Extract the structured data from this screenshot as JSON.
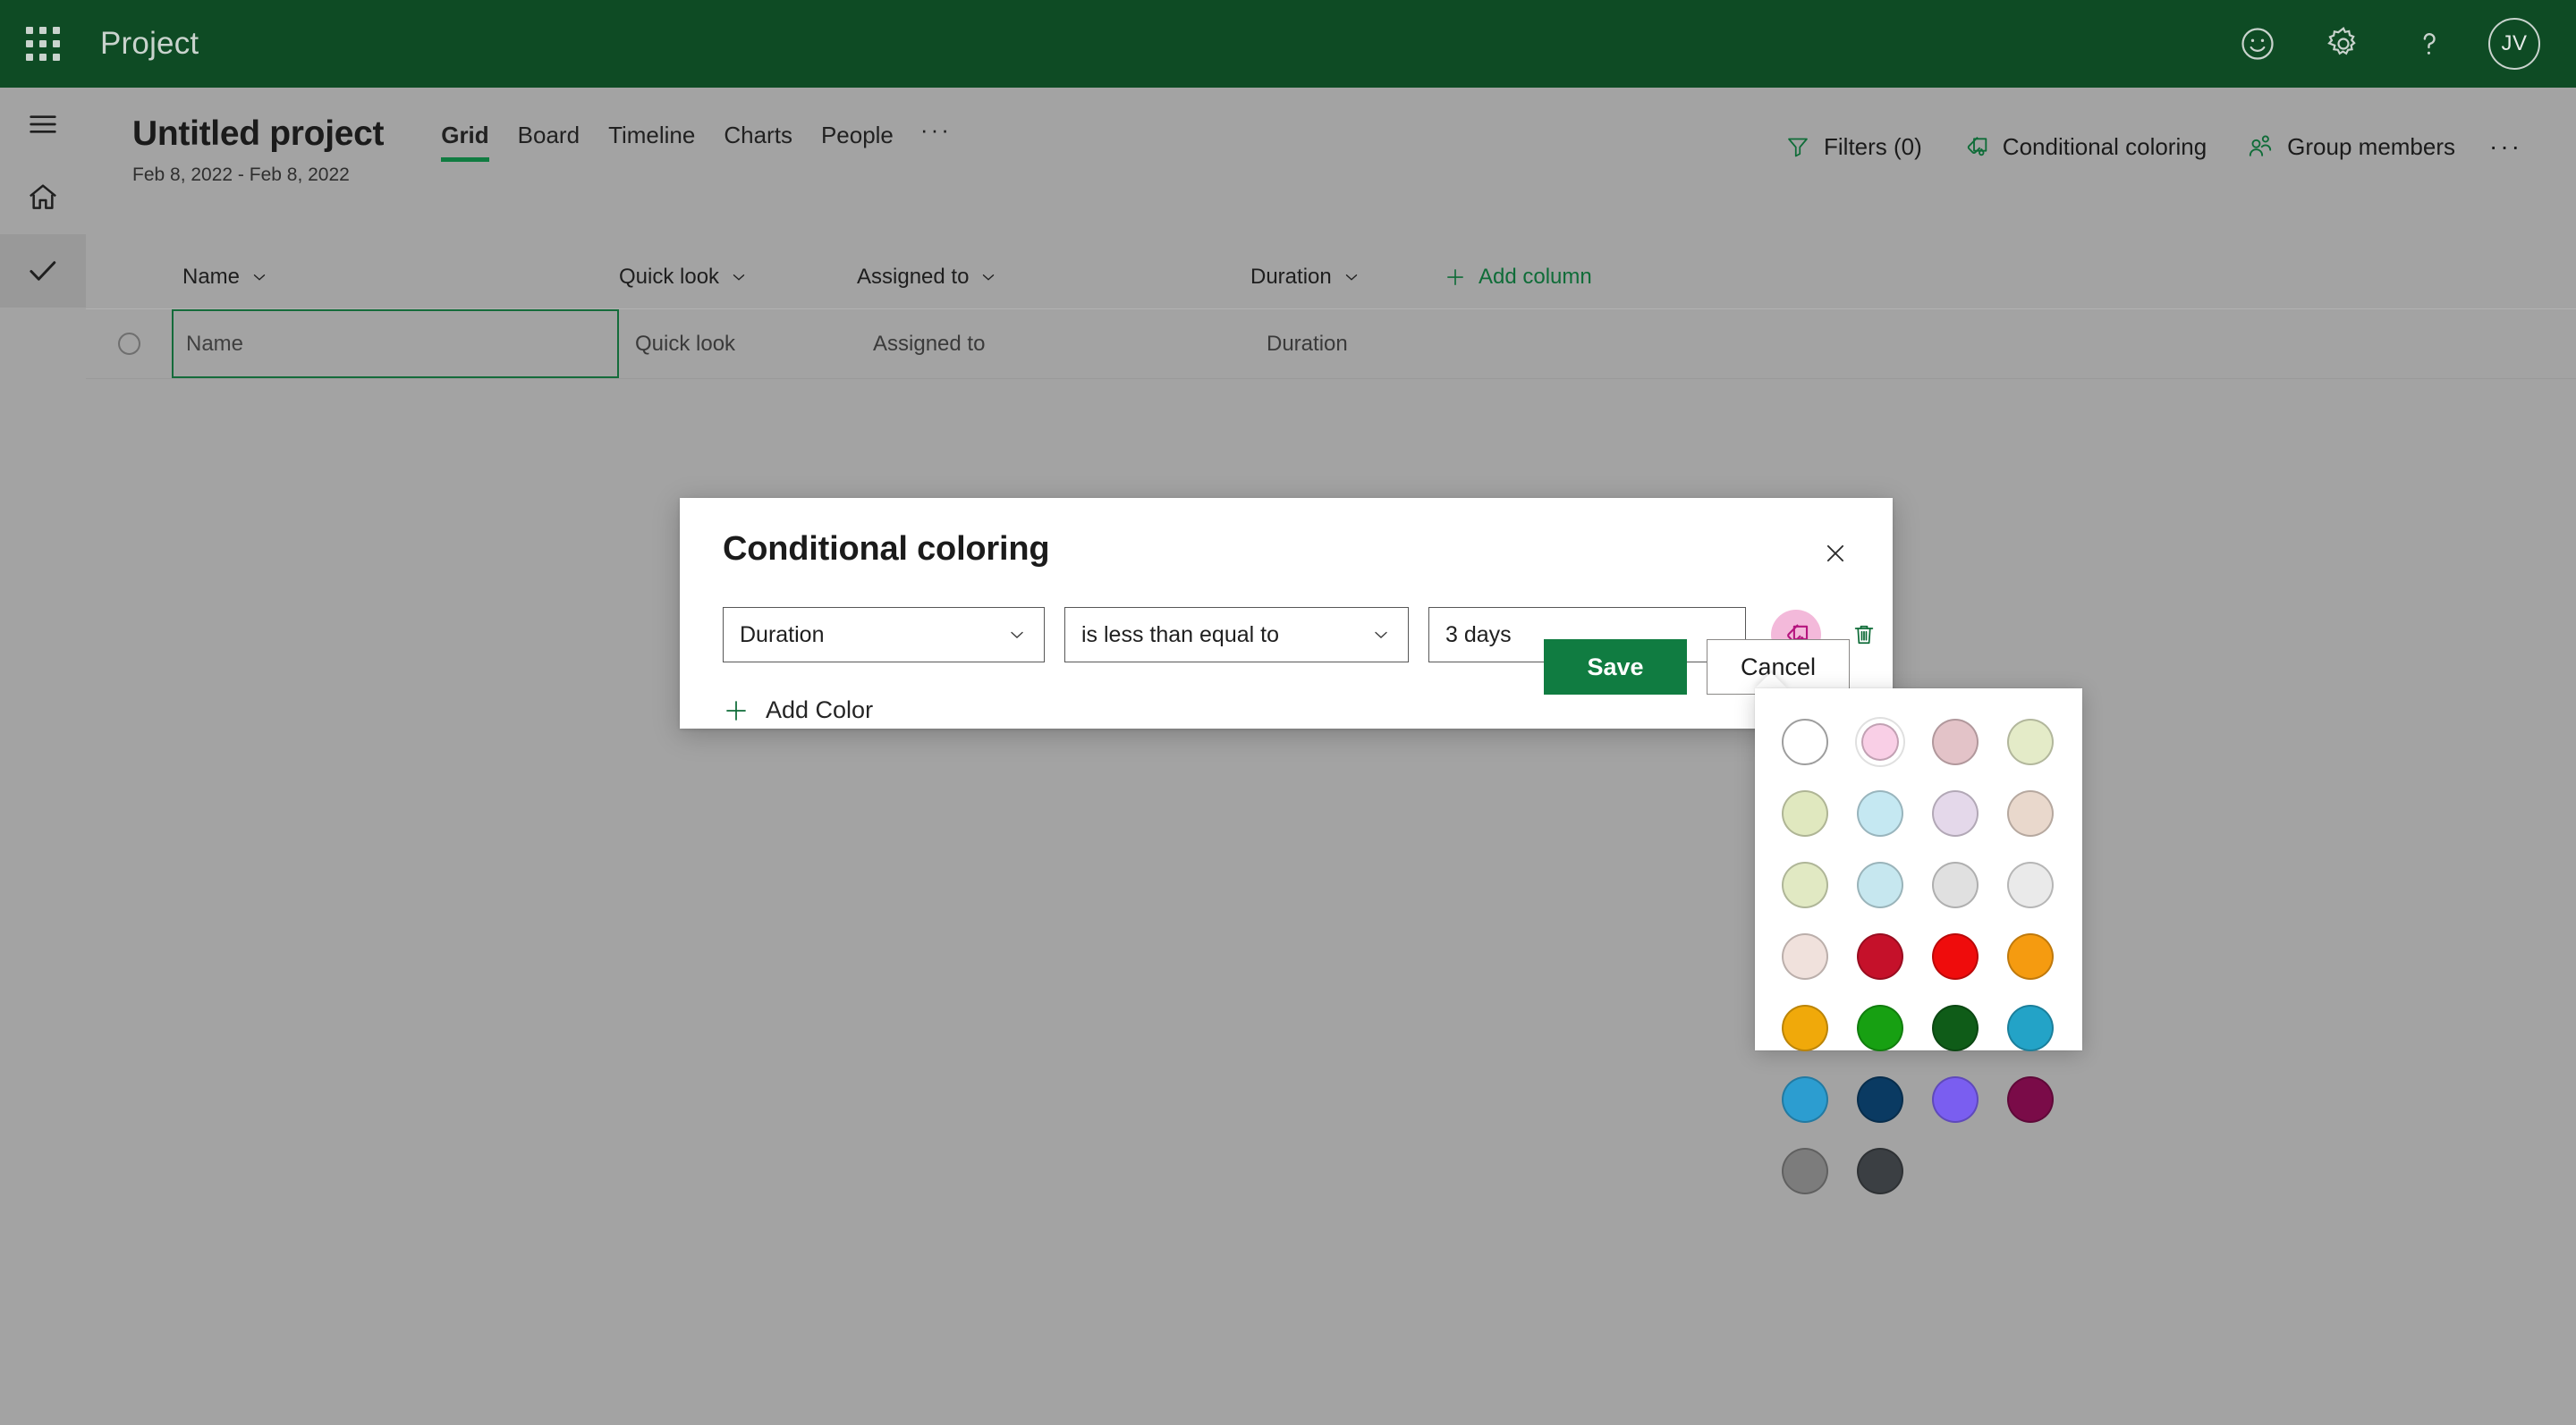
{
  "suite": {
    "waffle_name": "app-launcher",
    "title": "Project",
    "icons": [
      {
        "name": "feedback-smiley-icon",
        "glyph": "smiley"
      },
      {
        "name": "settings-gear-icon",
        "glyph": "gear"
      },
      {
        "name": "help-question-icon",
        "glyph": "question"
      }
    ],
    "avatar_initials": "JV",
    "bar_color": "#0e4b24"
  },
  "rail": {
    "items": [
      {
        "name": "hamburger-menu-icon",
        "label": "Menu",
        "active": false
      },
      {
        "name": "home-icon",
        "label": "Home",
        "active": false
      },
      {
        "name": "tasks-check-icon",
        "label": "Tasks",
        "active": true
      }
    ]
  },
  "header": {
    "project_title": "Untitled project",
    "project_dates": "Feb 8, 2022 - Feb 8, 2022",
    "tabs": [
      {
        "label": "Grid",
        "active": true
      },
      {
        "label": "Board",
        "active": false
      },
      {
        "label": "Timeline",
        "active": false
      },
      {
        "label": "Charts",
        "active": false
      },
      {
        "label": "People",
        "active": false
      }
    ],
    "tab_overflow": "···",
    "actions": [
      {
        "label": "Filters (0)",
        "icon": "filter-icon"
      },
      {
        "label": "Conditional coloring",
        "icon": "paint-bucket-icon"
      },
      {
        "label": "Group members",
        "icon": "people-icon"
      }
    ],
    "actions_overflow": "···",
    "accent_color": "#107c41"
  },
  "grid": {
    "columns": [
      {
        "label": "Name"
      },
      {
        "label": "Quick look"
      },
      {
        "label": "Assigned to"
      },
      {
        "label": "Duration"
      }
    ],
    "add_column_label": "Add column",
    "rows": [
      {
        "name": "Name",
        "quick_look": "Quick look",
        "assigned_to": "Assigned to",
        "duration": "Duration"
      }
    ]
  },
  "dialog": {
    "title": "Conditional coloring",
    "close_label": "Close",
    "rule": {
      "field_value": "Duration",
      "operator_value": "is less than equal to",
      "value_text": "3 days",
      "color_button_name": "color-swatch-button",
      "current_color": "#f3b9da",
      "delete_label": "Delete"
    },
    "add_color_label": "Add Color",
    "save_label": "Save",
    "cancel_label": "Cancel"
  },
  "color_picker": {
    "swatches": [
      {
        "hex": "#ffffff",
        "name": "white",
        "selected": false
      },
      {
        "hex": "#f9cfe6",
        "name": "light-pink",
        "selected": true
      },
      {
        "hex": "#e3c3c8",
        "name": "dusty-rose",
        "selected": false
      },
      {
        "hex": "#e4ebc8",
        "name": "pale-lime",
        "selected": false
      },
      {
        "hex": "#e0e8bf",
        "name": "light-olive",
        "selected": false
      },
      {
        "hex": "#c5e8f2",
        "name": "pale-cyan",
        "selected": false
      },
      {
        "hex": "#e4d8ea",
        "name": "pale-lavender",
        "selected": false
      },
      {
        "hex": "#e9d8cc",
        "name": "pale-peach",
        "selected": false
      },
      {
        "hex": "#e1e9c3",
        "name": "pale-green",
        "selected": false
      },
      {
        "hex": "#c6e7ef",
        "name": "ice-blue",
        "selected": false
      },
      {
        "hex": "#e0e0e0",
        "name": "light-gray",
        "selected": false
      },
      {
        "hex": "#eaeaea",
        "name": "off-white",
        "selected": false
      },
      {
        "hex": "#f0e1dc",
        "name": "blush",
        "selected": false
      },
      {
        "hex": "#c5112a",
        "name": "crimson",
        "selected": false
      },
      {
        "hex": "#ef0c0c",
        "name": "red",
        "selected": false
      },
      {
        "hex": "#f59b10",
        "name": "orange",
        "selected": false
      },
      {
        "hex": "#f0a90a",
        "name": "amber",
        "selected": false
      },
      {
        "hex": "#17a012",
        "name": "green",
        "selected": false
      },
      {
        "hex": "#0f5c18",
        "name": "dark-green",
        "selected": false
      },
      {
        "hex": "#23a3c7",
        "name": "sky-blue",
        "selected": false
      },
      {
        "hex": "#2c9dd0",
        "name": "blue",
        "selected": false
      },
      {
        "hex": "#0a3a62",
        "name": "navy",
        "selected": false
      },
      {
        "hex": "#7a5ef0",
        "name": "violet",
        "selected": false
      },
      {
        "hex": "#7a0b48",
        "name": "magenta",
        "selected": false
      },
      {
        "hex": "#7c7c7c",
        "name": "gray",
        "selected": false
      },
      {
        "hex": "#3b3f43",
        "name": "charcoal",
        "selected": false
      }
    ]
  }
}
